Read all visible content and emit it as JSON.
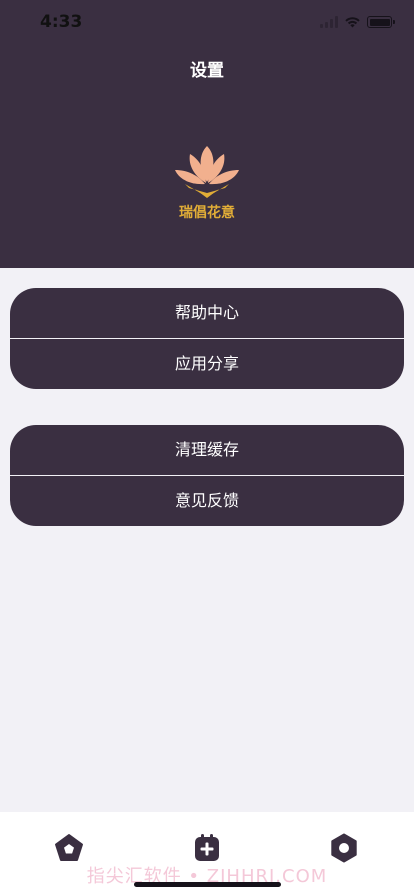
{
  "status_bar": {
    "time": "4:33"
  },
  "header": {
    "title": "设置",
    "logo_text": "瑞倡花意"
  },
  "menu": {
    "group1": [
      {
        "label": "帮助中心"
      },
      {
        "label": "应用分享"
      }
    ],
    "group2": [
      {
        "label": "清理缓存"
      },
      {
        "label": "意见反馈"
      }
    ]
  },
  "tab_bar": {
    "items": [
      {
        "icon": "pentagon-home-icon"
      },
      {
        "icon": "calendar-add-icon"
      },
      {
        "icon": "hexagon-settings-icon"
      }
    ]
  },
  "watermark": "指尖汇软件 • ZJHHRJ.COM",
  "colors": {
    "header_bg": "#3a2f41",
    "page_bg": "#f2f1f6",
    "logo_petal": "#f2b08e",
    "logo_gold": "#e1ad37"
  }
}
